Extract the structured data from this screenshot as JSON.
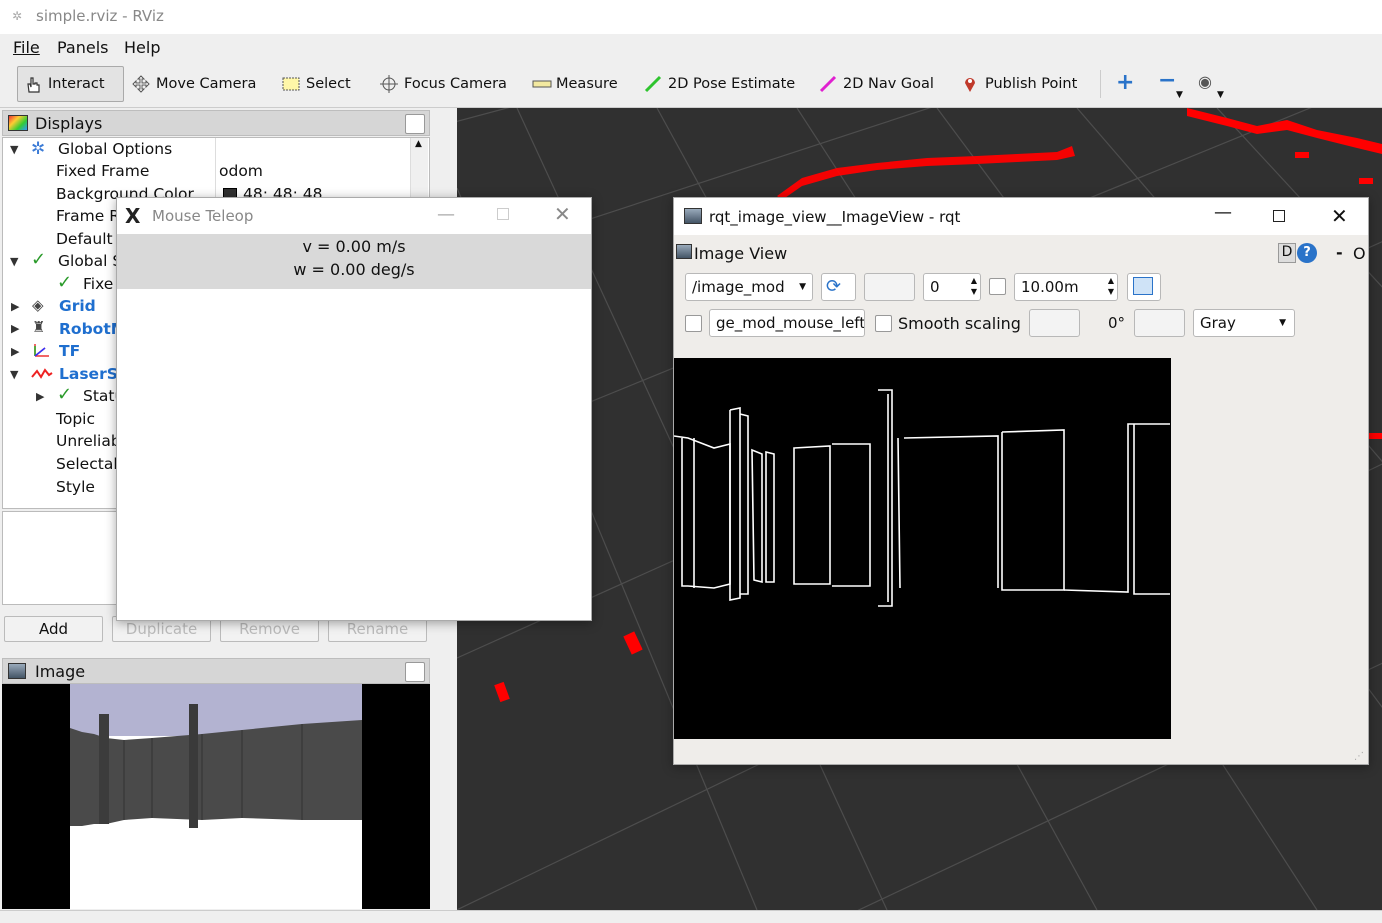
{
  "window": {
    "title": "simple.rviz - RViz"
  },
  "menu": [
    "File",
    "Panels",
    "Help"
  ],
  "toolbar": {
    "interact": "Interact",
    "move_camera": "Move Camera",
    "select": "Select",
    "focus_camera": "Focus Camera",
    "measure": "Measure",
    "pose_estimate": "2D Pose Estimate",
    "nav_goal": "2D Nav Goal",
    "publish_point": "Publish Point"
  },
  "displays": {
    "title": "Displays",
    "rows": {
      "global_options": "Global Options",
      "fixed_frame": "Fixed Frame",
      "fixed_frame_value": "odom",
      "background_color": "Background Color",
      "background_color_value": "48; 48; 48",
      "frame_rate": "Frame R",
      "default_light": "Default",
      "global_status": "Global S",
      "fixed_status": "Fixe",
      "grid": "Grid",
      "robot_model": "RobotM",
      "tf": "TF",
      "laser_scan": "LaserS",
      "status": "Statu",
      "topic": "Topic",
      "unreliable": "Unreliab",
      "selectable": "Selectab",
      "style": "Style"
    },
    "buttons": {
      "add": "Add",
      "duplicate": "Duplicate",
      "remove": "Remove",
      "rename": "Rename"
    }
  },
  "image_panel": {
    "title": "Image"
  },
  "teleop": {
    "title": "Mouse Teleop",
    "v_line": "v = 0.00 m/s",
    "w_line": "w = 0.00 deg/s"
  },
  "rqt": {
    "title": "rqt_image_view__ImageView - rqt",
    "plugin_title": "Image View",
    "help_d": "D",
    "help_dash": "-",
    "help_o": "O",
    "topic": "/image_mod",
    "blank1": "",
    "num_value": "0",
    "max_range": "10.00m",
    "mouse_topic": "ge_mod_mouse_left",
    "smooth_scaling": "Smooth scaling",
    "rotation": "0°",
    "color_scheme": "Gray"
  },
  "colors": {
    "viewport_bg": "#303030",
    "grid_line": "#4a4a4a",
    "laser": "#ff0000",
    "accent_blue": "#1f6fcf",
    "sky": "#b3b3d1"
  }
}
